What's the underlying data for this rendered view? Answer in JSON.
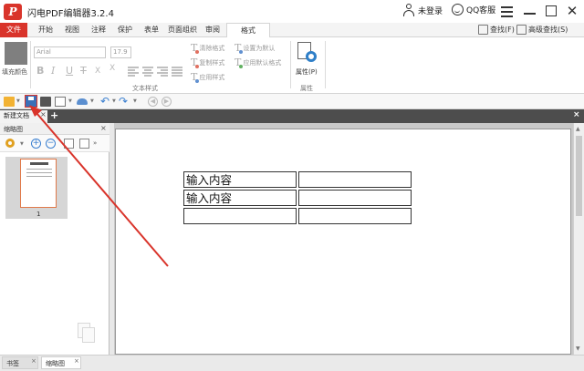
{
  "window": {
    "title": "闪电PDF编辑器3.2.4",
    "logo_letter": "P",
    "login_label": "未登录",
    "qq_label": "QQ客服",
    "close_glyph": "✕"
  },
  "ribbon_tabs": {
    "file": "文件",
    "items": [
      "开始",
      "视图",
      "注释",
      "保护",
      "表单",
      "页面组织",
      "审阅"
    ],
    "format": "格式",
    "find": "查找(F)",
    "advanced_find": "高级查找(S)"
  },
  "ribbon": {
    "fill_color_label": "填充颜色",
    "font_family_value": "Arial",
    "font_size_value": "17.9",
    "format_glyphs": [
      "B",
      "I",
      "U",
      "T",
      "X",
      "X"
    ],
    "text_style_caption": "文本样式",
    "clear_style": "清除格式",
    "copy_style": "复制样式",
    "apply_style": "应用样式",
    "set_default": "设置为默认",
    "apply_default": "应用默认格式",
    "properties_label": "属性(P)",
    "properties_caption": "属性"
  },
  "doc_tabs": {
    "active": "新建文档",
    "close_glyph": "×",
    "add_glyph": "+"
  },
  "panel": {
    "title": "缩略图",
    "close_glyph": "×",
    "page_number": "1"
  },
  "document": {
    "rows": [
      [
        "输入内容",
        ""
      ],
      [
        "输入内容",
        ""
      ],
      [
        "",
        ""
      ]
    ]
  },
  "bottom_tabs": {
    "bookmarks": "书签",
    "thumbnails": "缩略图",
    "close_glyph": "×"
  },
  "icons": {
    "logo": "app-logo-icon",
    "user": "user-icon",
    "support": "smile-icon",
    "save": "save-icon",
    "properties": "document-gear-icon"
  },
  "colors": {
    "brand_red": "#d9342b",
    "accent_blue": "#3a7fd0",
    "annotation_arrow": "#d9342b"
  }
}
